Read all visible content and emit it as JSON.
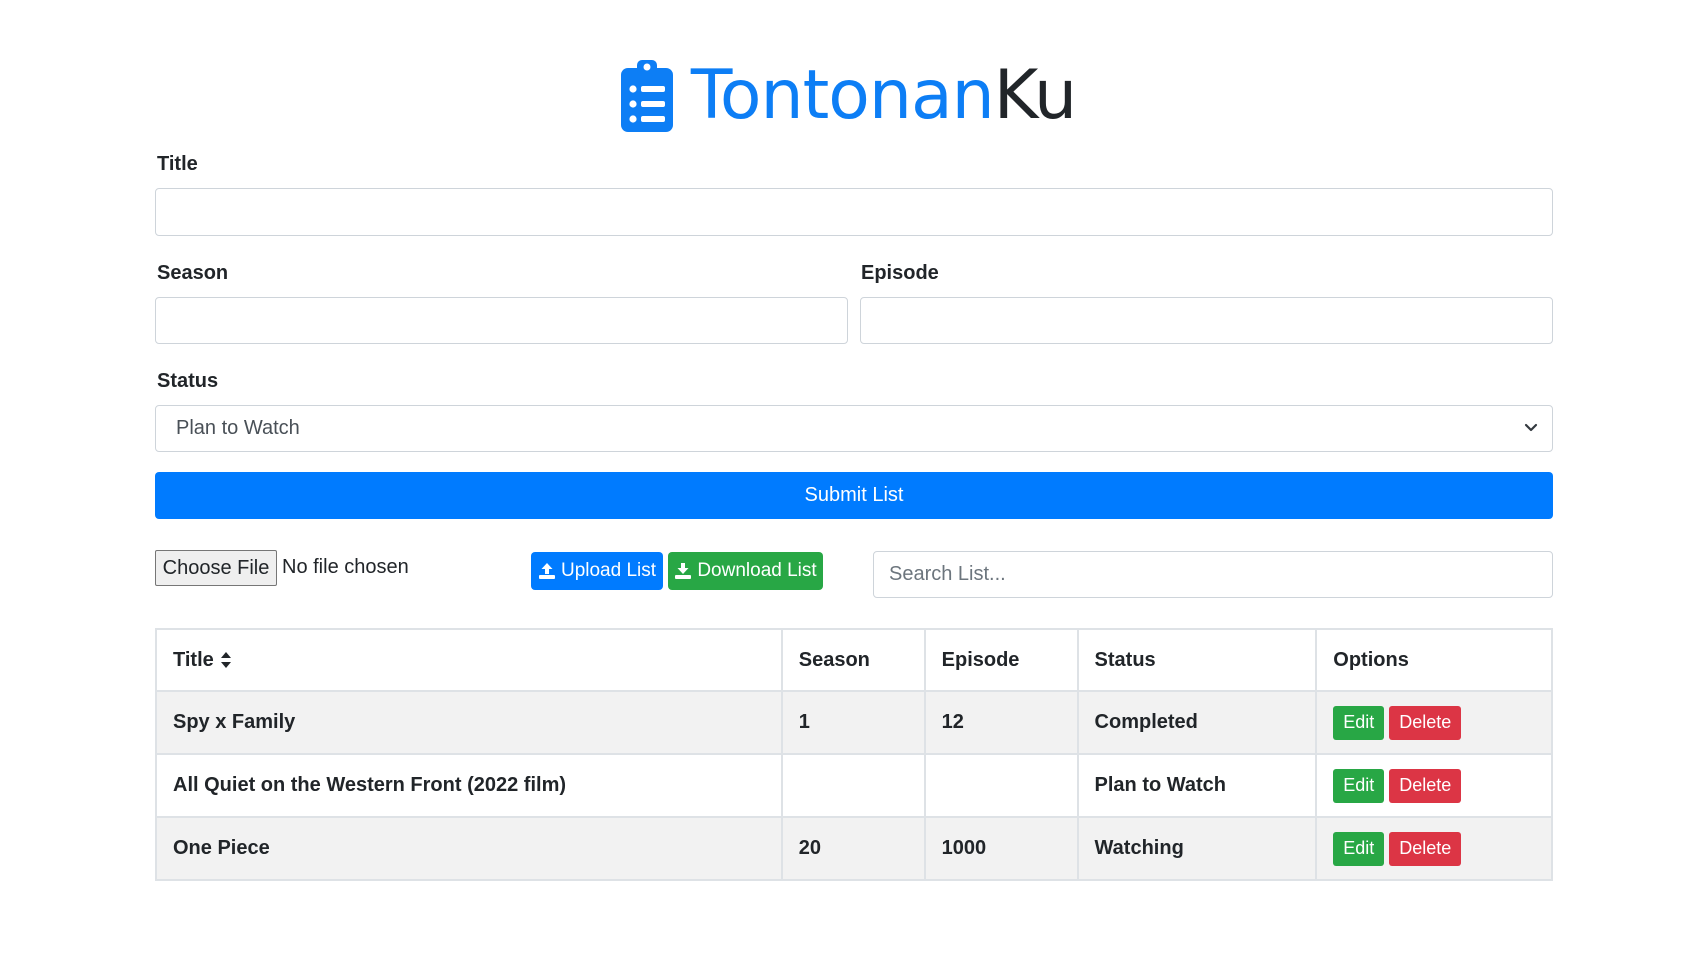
{
  "brand": {
    "part1": "Tonton",
    "part2": "an",
    "part3": "Ku",
    "accent": "#0d7ef5"
  },
  "form": {
    "title_label": "Title",
    "title_value": "",
    "season_label": "Season",
    "season_value": "",
    "episode_label": "Episode",
    "episode_value": "",
    "status_label": "Status",
    "status_selected": "Plan to Watch",
    "submit_label": "Submit List"
  },
  "toolbar": {
    "choose_file_label": "Choose File",
    "file_status": "No file chosen",
    "upload_label": "Upload List",
    "download_label": "Download List",
    "search_placeholder": "Search List..."
  },
  "table": {
    "headers": [
      "Title",
      "Season",
      "Episode",
      "Status",
      "Options"
    ],
    "rows": [
      {
        "title": "Spy x Family",
        "season": "1",
        "episode": "12",
        "status": "Completed"
      },
      {
        "title": "All Quiet on the Western Front (2022 film)",
        "season": "",
        "episode": "",
        "status": "Plan to Watch"
      },
      {
        "title": "One Piece",
        "season": "20",
        "episode": "1000",
        "status": "Watching"
      }
    ],
    "edit_label": "Edit",
    "delete_label": "Delete"
  },
  "colors": {
    "primary": "#007bff",
    "success": "#28a745",
    "danger": "#dc3545"
  }
}
